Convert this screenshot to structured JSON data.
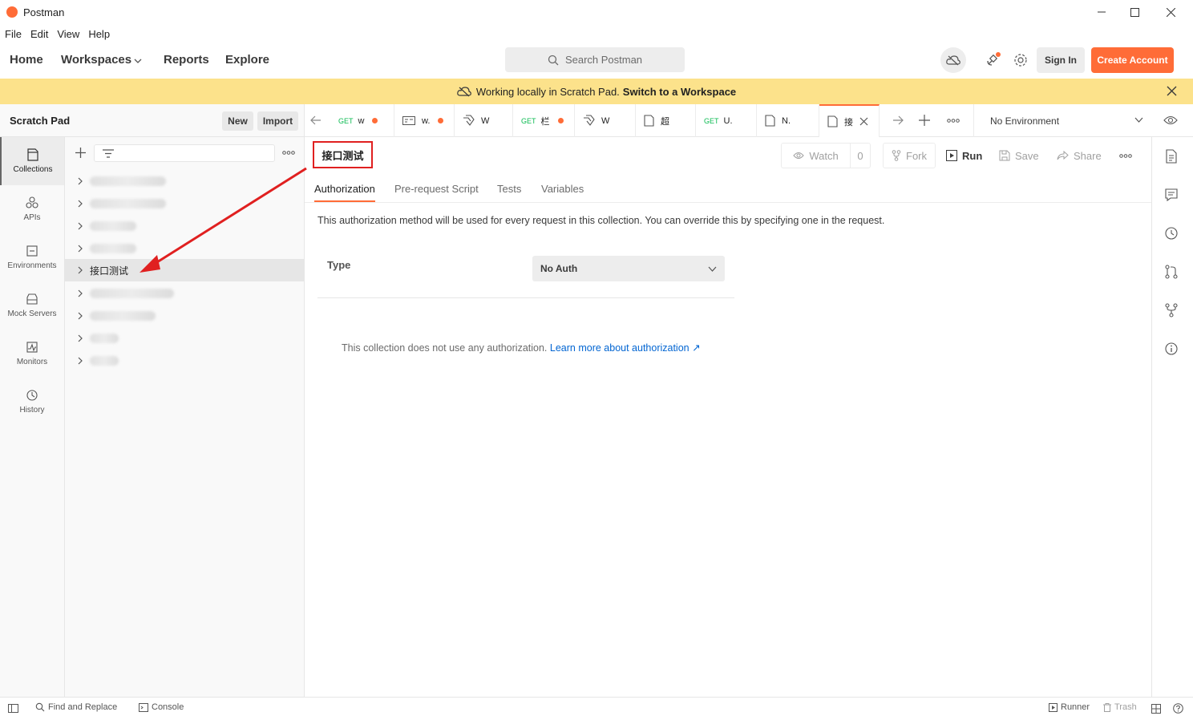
{
  "window": {
    "title": "Postman",
    "minimize_icon": "minimize-icon",
    "maximize_icon": "maximize-icon",
    "close_icon": "close-icon"
  },
  "menu": {
    "items": [
      "File",
      "Edit",
      "View",
      "Help"
    ]
  },
  "header": {
    "nav": [
      "Home",
      "Workspaces",
      "Reports",
      "Explore"
    ],
    "search_placeholder": "Search Postman",
    "sign_in": "Sign In",
    "create_account": "Create Account"
  },
  "banner": {
    "text": "Working locally in Scratch Pad.",
    "link": "Switch to a Workspace"
  },
  "scratch_pad": {
    "title": "Scratch Pad",
    "new_label": "New",
    "import_label": "Import"
  },
  "rail": {
    "items": [
      {
        "label": "Collections",
        "icon": "collections-icon",
        "active": true
      },
      {
        "label": "APIs",
        "icon": "apis-icon",
        "active": false
      },
      {
        "label": "Environments",
        "icon": "environments-icon",
        "active": false
      },
      {
        "label": "Mock Servers",
        "icon": "mock-servers-icon",
        "active": false
      },
      {
        "label": "Monitors",
        "icon": "monitors-icon",
        "active": false
      },
      {
        "label": "History",
        "icon": "history-icon",
        "active": false
      }
    ]
  },
  "collections": {
    "selected_name": "接口测试"
  },
  "tabs": [
    {
      "method": "GET",
      "name": "w",
      "unsaved": true
    },
    {
      "method": "",
      "name": "w.",
      "unsaved": true
    },
    {
      "method": "",
      "name": "W",
      "unsaved": false
    },
    {
      "method": "GET",
      "name": "栏",
      "unsaved": true
    },
    {
      "method": "",
      "name": "W",
      "unsaved": false
    },
    {
      "method": "",
      "name": "超",
      "unsaved": false
    },
    {
      "method": "GET",
      "name": "U.",
      "unsaved": false
    },
    {
      "method": "",
      "name": "N.",
      "unsaved": false
    },
    {
      "method": "",
      "name": "接",
      "unsaved": false,
      "active": true
    }
  ],
  "environment": {
    "selected": "No Environment"
  },
  "main": {
    "collection_title": "接口测试",
    "watch_label": "Watch",
    "watch_count": "0",
    "fork_label": "Fork",
    "run_label": "Run",
    "save_label": "Save",
    "share_label": "Share",
    "subtabs": [
      "Authorization",
      "Pre-request Script",
      "Tests",
      "Variables"
    ],
    "description": "This authorization method will be used for every request in this collection. You can override this by specifying one in the request.",
    "type_label": "Type",
    "type_value": "No Auth",
    "no_auth_text": "This collection does not use any authorization.",
    "learn_more": "Learn more about authorization ↗"
  },
  "status": {
    "find_replace": "Find and Replace",
    "console": "Console",
    "runner": "Runner",
    "trash": "Trash"
  },
  "colors": {
    "accent": "#ff6c37",
    "banner": "#fce28b",
    "annotation": "#e02020",
    "link": "#0265d2"
  }
}
